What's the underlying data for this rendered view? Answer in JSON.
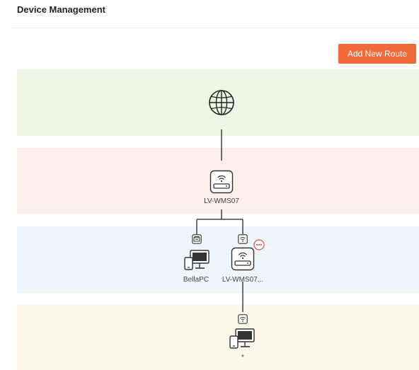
{
  "header": {
    "title": "Device Management"
  },
  "toolbar": {
    "add_route_label": "Add New Route"
  },
  "topology": {
    "main_router": {
      "name": "LV-WMS07"
    },
    "wired_client": {
      "name": "BellaPC"
    },
    "mesh_node": {
      "name": "LV-WMS07..."
    },
    "node_client": {
      "name": "*"
    }
  },
  "colors": {
    "accent": "#f26a3a",
    "internet_band": "#eef5e4",
    "router_band": "#fbeeec",
    "level2_band": "#eef6fc",
    "level3_band": "#fcf9ec",
    "more_button": "#e8504a"
  },
  "icons": [
    "globe-icon",
    "router-icon",
    "ethernet-icon",
    "wifi-icon",
    "client-devices-icon",
    "more-options-icon"
  ]
}
